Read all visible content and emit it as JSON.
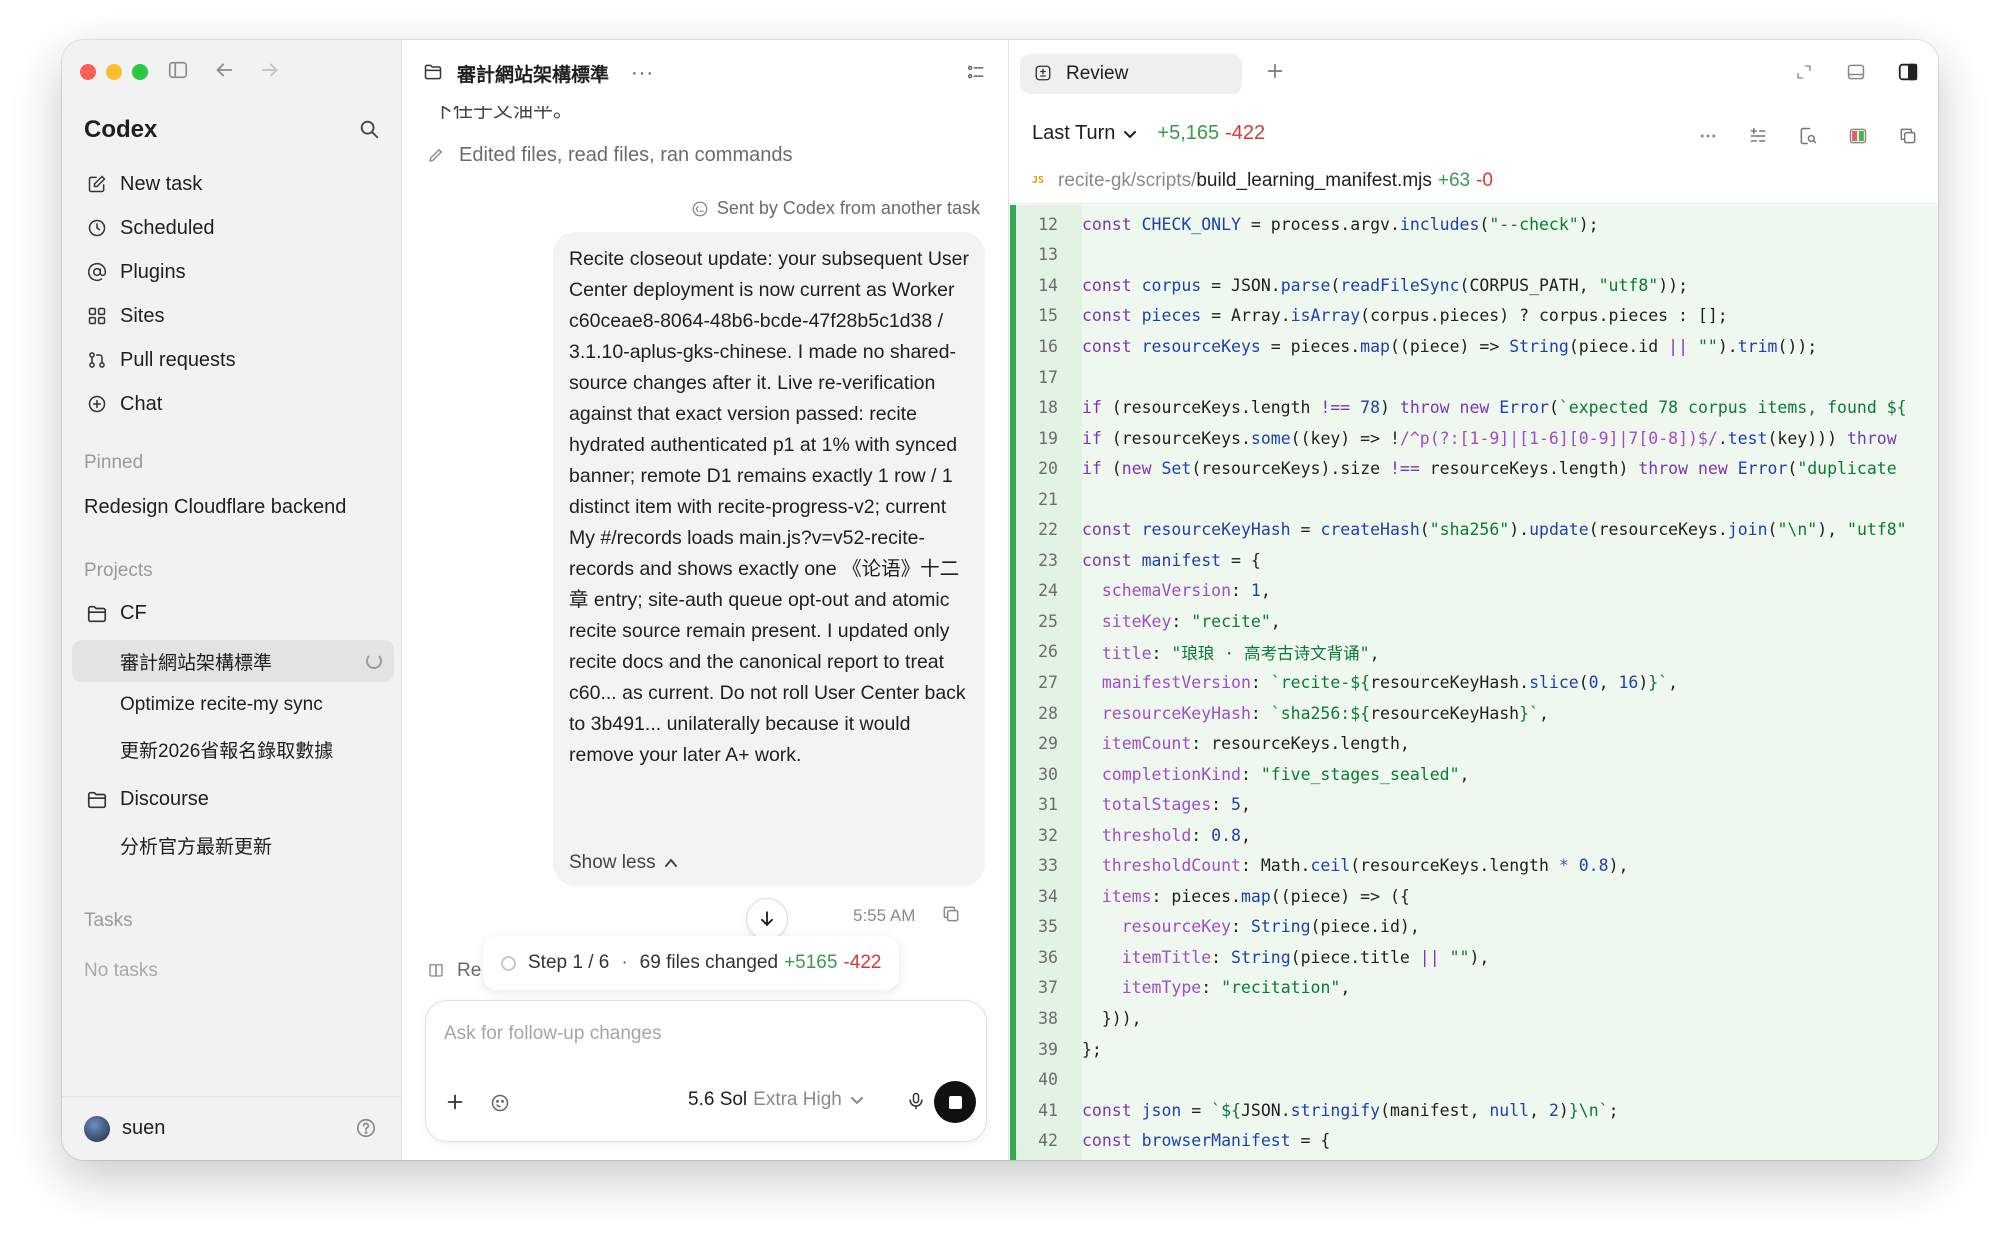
{
  "sidebar": {
    "brand": "Codex",
    "nav": [
      {
        "label": "New task",
        "icon": "edit-icon"
      },
      {
        "label": "Scheduled",
        "icon": "clock-icon"
      },
      {
        "label": "Plugins",
        "icon": "at-icon"
      },
      {
        "label": "Sites",
        "icon": "grid-icon"
      },
      {
        "label": "Pull requests",
        "icon": "pull-request-icon"
      },
      {
        "label": "Chat",
        "icon": "plus-circle-icon"
      }
    ],
    "pinned_label": "Pinned",
    "pinned_item": "Redesign Cloudflare backend",
    "projects_label": "Projects",
    "projects": [
      {
        "name": "CF",
        "threads": [
          "審計網站架構標準",
          "Optimize recite-my sync",
          "更新2026省報名錄取數據"
        ]
      },
      {
        "name": "Discourse",
        "threads": [
          "分析官方最新更新"
        ]
      }
    ],
    "tasks_label": "Tasks",
    "no_tasks": "No tasks",
    "user": "suen"
  },
  "chat": {
    "title": "審計網站架構標準",
    "more": "···",
    "cut_line": "下任于义油平。",
    "activity": "Edited files, read files, ran commands",
    "sent_by": "Sent by Codex from another task",
    "message": "Recite closeout update: your subsequent User Center deployment is now current as Worker c60ceae8-8064-48b6-bcde-47f28b5c1d38 / 3.1.10-aplus-gks-chinese. I made no shared-source changes after it. Live re-verification against that exact version passed: recite hydrated authenticated p1 at 1% with synced banner; remote D1 remains exactly 1 row / 1 distinct item with recite-progress-v2; current My #/records loads main.js?v=v52-recite-records and shows exactly one 《论语》十二章 entry; site-auth queue opt-out and atomic recite source remain present. I updated only recite docs and the canonical report to treat c60... as current. Do not roll User Center back to 3b491... unilaterally because it would remove your later A+ work.",
    "show_less": "Show less",
    "time": "5:55 AM",
    "re_label": "Re",
    "step": {
      "text": "Step 1 / 6",
      "dot": "·",
      "files": "69 files changed",
      "added": "+5165",
      "removed": "-422"
    },
    "composer": {
      "placeholder": "Ask for follow-up changes",
      "model": "5.6 Sol",
      "effort": "Extra High"
    }
  },
  "review": {
    "tab": "Review",
    "scope": "Last Turn",
    "added": "+5,165",
    "removed": "-422",
    "file_dir": "recite-gk/scripts/",
    "file_name": "build_learning_manifest.mjs",
    "file_added": "+63",
    "file_removed": "-0",
    "file_badge": "JS",
    "code_color": "#eef8ee"
  }
}
